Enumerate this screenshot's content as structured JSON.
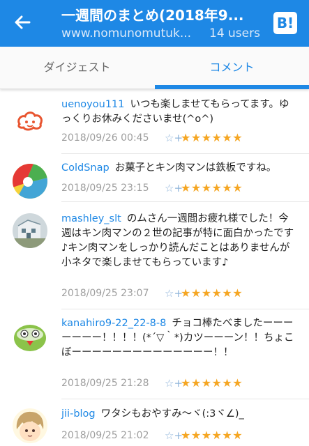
{
  "header": {
    "title": "一週間のまとめ(2018年9...",
    "url": "www.nomunomutuk...",
    "users": "14 users",
    "bookmark_button": "B!"
  },
  "tabs": [
    {
      "label": "ダイジェスト",
      "active": false
    },
    {
      "label": "コメント",
      "active": true
    }
  ],
  "comments": [
    {
      "user": "uenoyou111",
      "text": "いつも楽しませてもらってます。ゆっくりお休みくださいませ(^o^)",
      "date": "2018/09/26 00:45",
      "stars": "★★★★★★"
    },
    {
      "user": "ColdSnap",
      "text": "お菓子とキン肉マンは鉄板ですね。",
      "date": "2018/09/25 23:15",
      "stars": "★★★★★★"
    },
    {
      "user": "mashley_slt",
      "text": "のムさん一週間お疲れ様でした！今週はキン肉マンの２世の記事が特に面白かったです♪キン肉マンをしっかり読んだことはありませんが小ネタで楽しませてもらっています♪",
      "date": "2018/09/25 23:07",
      "stars": "★★★★★★"
    },
    {
      "user": "kanahiro9-22_22-8-8",
      "text": "チョコ棒たべましたーーーーーーー！！！！(*´▽｀*)カツーーーン！！ちょこぼーーーーーーーーーーーーーー！！",
      "date": "2018/09/25 21:28",
      "stars": "★★★★★★"
    },
    {
      "user": "jii-blog",
      "text": "ワタシもおやすみ〜ヾ(:3ヾ∠)_",
      "date": "2018/09/25 21:02",
      "stars": "★★★★★★"
    }
  ],
  "star_add_icon": "☆+",
  "colors": {
    "accent": "#1e88e5",
    "star": "#f5a623"
  }
}
